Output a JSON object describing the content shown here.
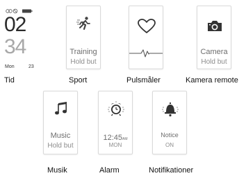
{
  "screens": {
    "tid": {
      "hour": "02",
      "minute": "34",
      "weekday": "Mon",
      "date": "23",
      "caption": "Tid"
    },
    "sport": {
      "title": "Training",
      "hint": "Hold but",
      "icon": "running-person-icon",
      "caption": "Sport"
    },
    "puls": {
      "icon": "heart-icon",
      "caption": "Pulsmåler"
    },
    "kamera": {
      "title": "Camera",
      "hint": "Hold but",
      "icon": "camera-icon",
      "caption": "Kamera remote"
    },
    "musik": {
      "title": "Music",
      "hint": "Hold but",
      "icon": "music-note-icon",
      "caption": "Musik"
    },
    "alarm": {
      "time": "12:45",
      "ampm": "AM",
      "day": "MON",
      "icon": "alarm-clock-icon",
      "caption": "Alarm"
    },
    "notis": {
      "title": "Notice",
      "state": "ON",
      "icon": "bell-icon",
      "caption": "Notifikationer"
    }
  },
  "colors": {
    "text_dark": "#222222",
    "text_gray": "#8c8c8c",
    "accent_gray": "#a8a8a8"
  }
}
